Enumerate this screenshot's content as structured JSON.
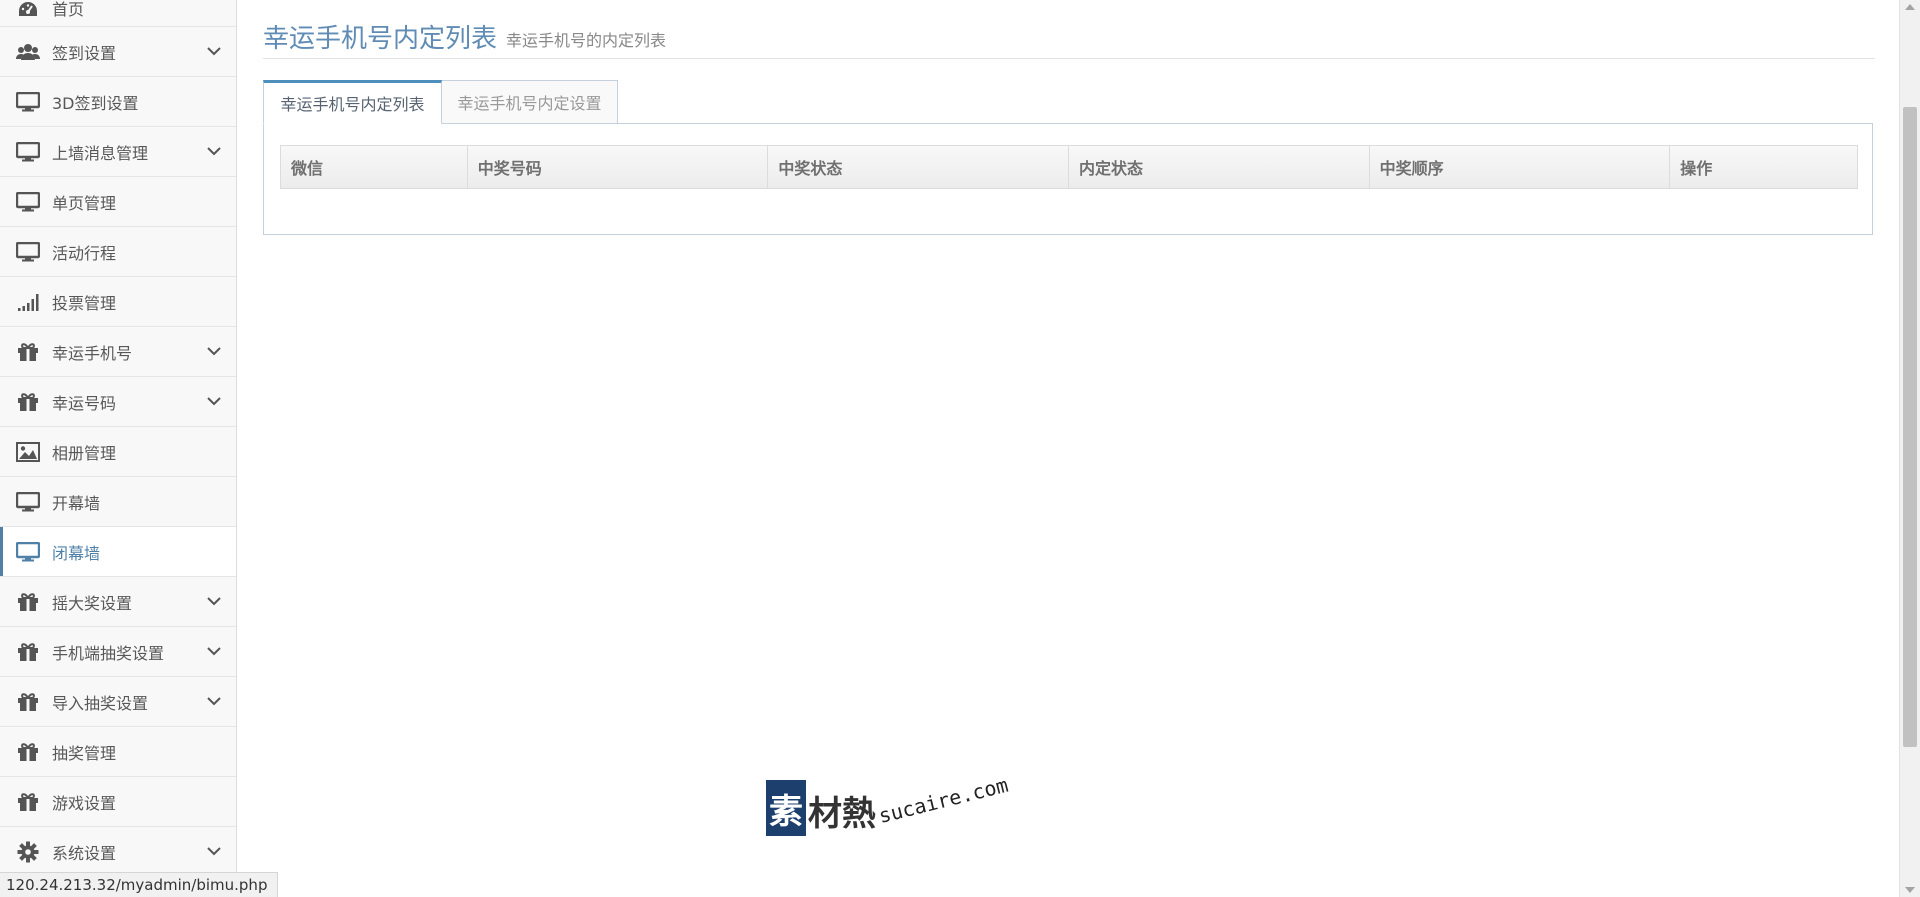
{
  "sidebar": {
    "items": [
      {
        "label": "首页",
        "icon": "dashboard-icon",
        "has_caret": false
      },
      {
        "label": "签到设置",
        "icon": "users-icon",
        "has_caret": true
      },
      {
        "label": "3D签到设置",
        "icon": "desktop-icon",
        "has_caret": false
      },
      {
        "label": "上墙消息管理",
        "icon": "desktop-icon",
        "has_caret": true
      },
      {
        "label": "单页管理",
        "icon": "desktop-icon",
        "has_caret": false
      },
      {
        "label": "活动行程",
        "icon": "desktop-icon",
        "has_caret": false
      },
      {
        "label": "投票管理",
        "icon": "signal-icon",
        "has_caret": false
      },
      {
        "label": "幸运手机号",
        "icon": "gift-icon",
        "has_caret": true
      },
      {
        "label": "幸运号码",
        "icon": "gift-icon",
        "has_caret": true
      },
      {
        "label": "相册管理",
        "icon": "picture-icon",
        "has_caret": false
      },
      {
        "label": "开幕墙",
        "icon": "desktop-icon",
        "has_caret": false
      },
      {
        "label": "闭幕墙",
        "icon": "desktop-icon",
        "has_caret": false,
        "active": true
      },
      {
        "label": "摇大奖设置",
        "icon": "gift-icon",
        "has_caret": true
      },
      {
        "label": "手机端抽奖设置",
        "icon": "gift-icon",
        "has_caret": true
      },
      {
        "label": "导入抽奖设置",
        "icon": "gift-icon",
        "has_caret": true
      },
      {
        "label": "抽奖管理",
        "icon": "gift-icon",
        "has_caret": false
      },
      {
        "label": "游戏设置",
        "icon": "gift-icon",
        "has_caret": false
      },
      {
        "label": "系统设置",
        "icon": "cog-icon",
        "has_caret": true
      }
    ]
  },
  "page": {
    "title": "幸运手机号内定列表",
    "subtitle": "幸运手机号的内定列表"
  },
  "tabs": [
    {
      "label": "幸运手机号内定列表",
      "active": true
    },
    {
      "label": "幸运手机号内定设置",
      "active": false
    }
  ],
  "table": {
    "columns": [
      "微信",
      "中奖号码",
      "中奖状态",
      "内定状态",
      "中奖顺序",
      "操作"
    ]
  },
  "watermark": {
    "logo_char": "素",
    "text": "材熱",
    "domain": "sucaire.com"
  },
  "statusbar": {
    "url": "120.24.213.32/myadmin/bimu.php"
  },
  "colors": {
    "accent": "#4f80a8",
    "title": "#5f8bb5",
    "sidebar_bg": "#f8f8f8",
    "border": "#c5d0dc"
  }
}
